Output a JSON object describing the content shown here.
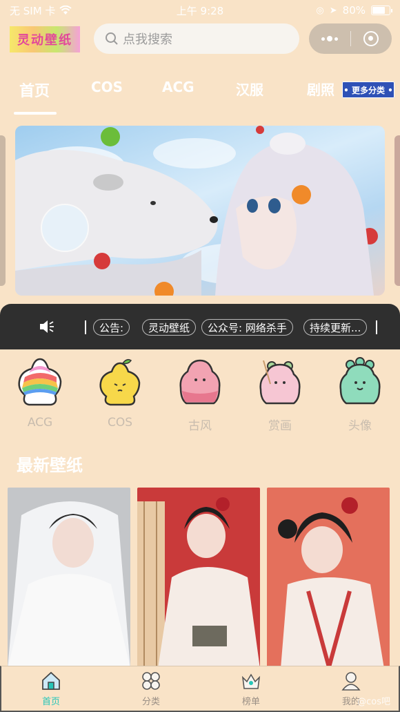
{
  "status_bar": {
    "carrier": "无 SIM 卡",
    "time": "上午 9:28",
    "battery": "80%",
    "battery_fraction": 0.8
  },
  "header": {
    "logo_text": "灵动壁纸",
    "search_placeholder": "点我搜索"
  },
  "tabs": {
    "items": [
      "首页",
      "COS",
      "ACG",
      "汉服",
      "剧照"
    ],
    "active_index": 0,
    "more_label": "• 更多分类 •"
  },
  "notice": {
    "chips": [
      "公告:",
      "灵动壁纸",
      "公众号: 网络杀手",
      "持续更新..."
    ]
  },
  "categories": [
    {
      "label": "ACG",
      "icon": "rainbow-star-icon"
    },
    {
      "label": "COS",
      "icon": "yellow-star-icon"
    },
    {
      "label": "古风",
      "icon": "pink-ghost-icon"
    },
    {
      "label": "赏画",
      "icon": "pink-bunny-icon"
    },
    {
      "label": "头像",
      "icon": "green-blob-icon"
    }
  ],
  "section": {
    "latest_title": "最新壁纸"
  },
  "bottom_nav": {
    "items": [
      "首页",
      "分类",
      "榜单",
      "我的"
    ],
    "active_index": 0,
    "watermark": "@cos吧"
  },
  "colors": {
    "background": "#f9e3c7",
    "notice_bg": "#2f2f2f",
    "active_nav": "#26c6b8",
    "more_badge": "#2e51b6"
  }
}
